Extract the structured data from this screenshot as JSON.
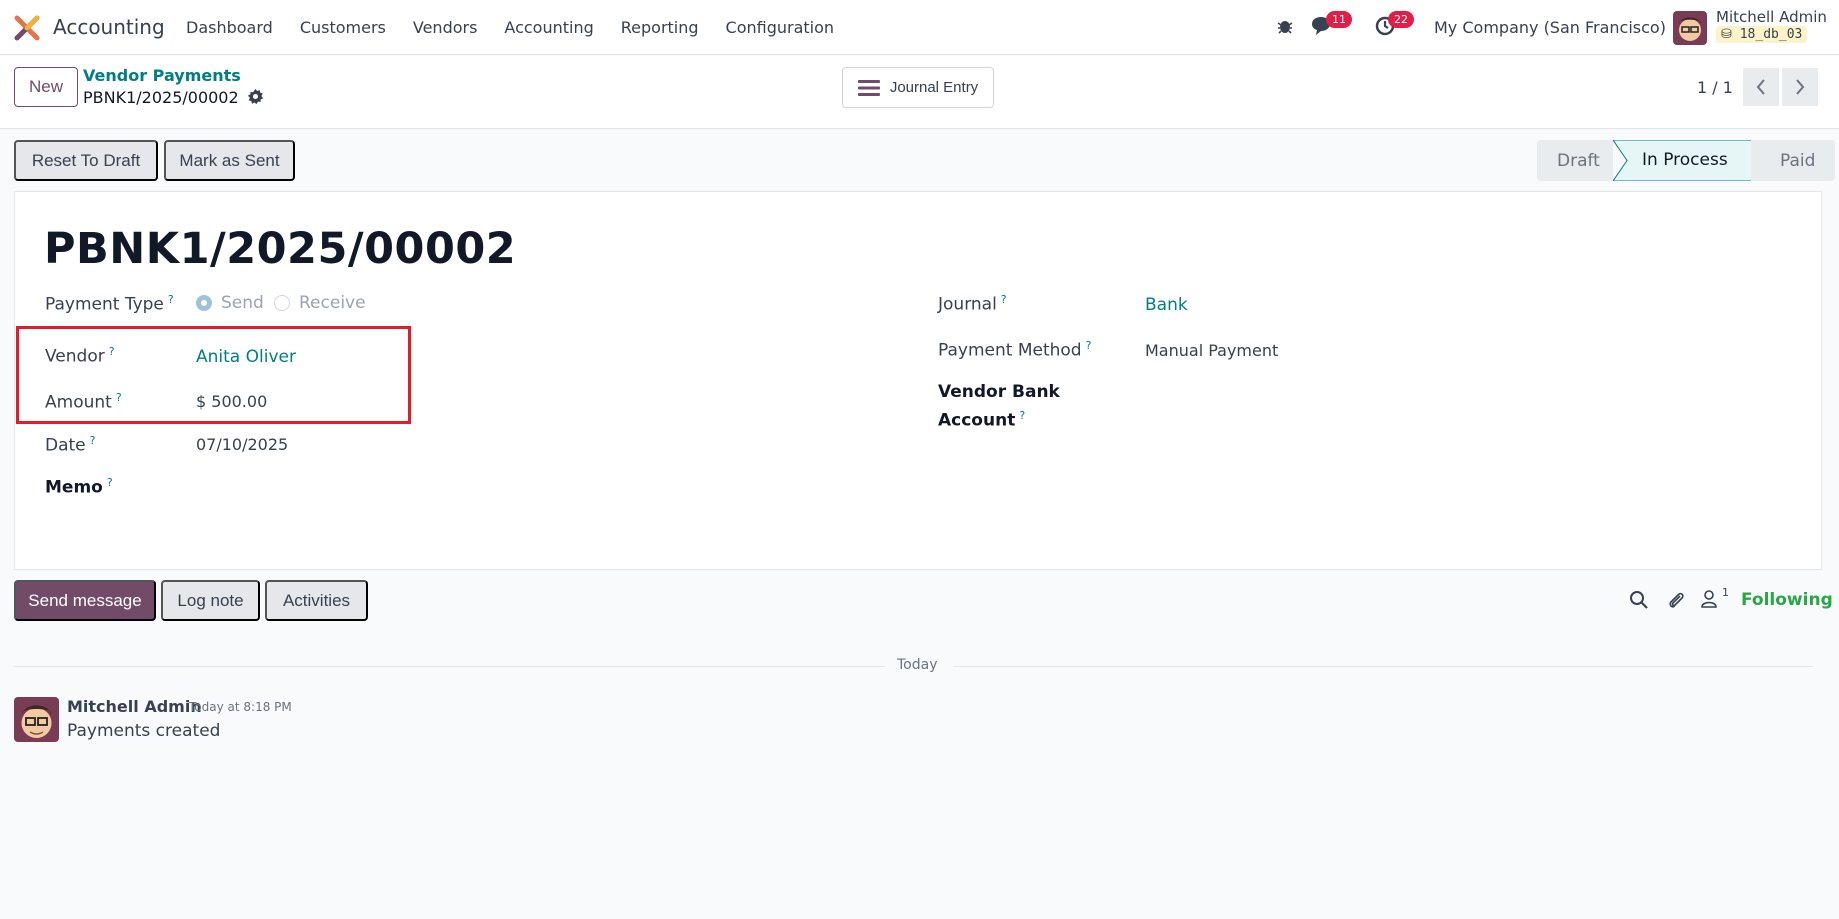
{
  "navbar": {
    "app_name": "Accounting",
    "menu": [
      "Dashboard",
      "Customers",
      "Vendors",
      "Accounting",
      "Reporting",
      "Configuration"
    ],
    "messages_count": "11",
    "activities_count": "22",
    "company": "My Company (San Francisco)",
    "user_name": "Mitchell Admin",
    "db_name": "18_db_03"
  },
  "control_panel": {
    "new_label": "New",
    "breadcrumb_parent": "Vendor Payments",
    "record_name": "PBNK1/2025/00002",
    "journal_entry_label": "Journal Entry",
    "pager": "1 / 1"
  },
  "actions": {
    "reset_to_draft": "Reset To Draft",
    "mark_as_sent": "Mark as Sent"
  },
  "statusbar": {
    "stages": [
      "Draft",
      "In Process",
      "Paid"
    ],
    "current": "In Process"
  },
  "form": {
    "title": "PBNK1/2025/00002",
    "payment_type_label": "Payment Type",
    "payment_type_options": [
      "Send",
      "Receive"
    ],
    "payment_type_selected": "Send",
    "vendor_label": "Vendor",
    "vendor_value": "Anita Oliver",
    "amount_label": "Amount",
    "amount_value": "$ 500.00",
    "date_label": "Date",
    "date_value": "07/10/2025",
    "memo_label": "Memo",
    "journal_label": "Journal",
    "journal_value": "Bank",
    "payment_method_label": "Payment Method",
    "payment_method_value": "Manual Payment",
    "vendor_bank_label_1": "Vendor Bank",
    "vendor_bank_label_2": "Account",
    "help_mark": "?"
  },
  "chatter": {
    "send_message": "Send message",
    "log_note": "Log note",
    "activities": "Activities",
    "followers_count": "1",
    "following": "Following",
    "date_separator": "Today",
    "message": {
      "author": "Mitchell Admin",
      "time": "Today at 8:18 PM",
      "body": "Payments created"
    }
  },
  "colors": {
    "brand": "#714b67",
    "link": "#017e84",
    "badge": "#e11d48",
    "following": "#28a745",
    "highlight": "#e11d2a"
  }
}
